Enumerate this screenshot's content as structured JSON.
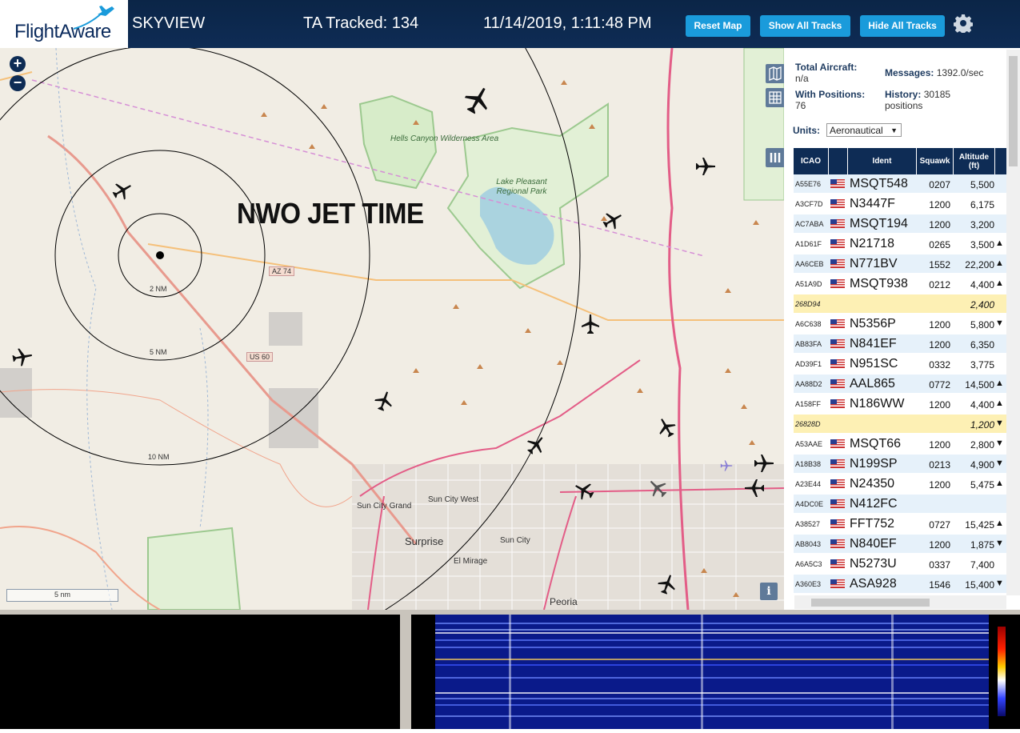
{
  "header": {
    "logo_text": "FlightAware",
    "app_name": "SKYVIEW",
    "ta_tracked": "TA Tracked: 134",
    "datetime": "11/14/2019, 1:11:48 PM",
    "buttons": {
      "reset_map": "Reset Map",
      "show_all_tracks": "Show All Tracks",
      "hide_all_tracks": "Hide All Tracks"
    }
  },
  "map": {
    "overlay_title": "NWO JET TIME",
    "range_rings": [
      "2 NM",
      "5 NM",
      "10 NM"
    ],
    "scale_label": "5 nm",
    "places": {
      "hells_canyon": "Hells Canyon Wilderness Area",
      "lake_pleasant": "Lake Pleasant Regional Park",
      "sun_city_grand": "Sun City Grand",
      "sun_city_west": "Sun City West",
      "surprise": "Surprise",
      "sun_city": "Sun City",
      "el_mirage": "El Mirage",
      "peoria": "Peoria"
    },
    "roads": {
      "az74": "AZ 74",
      "us60": "US 60"
    }
  },
  "sidebar": {
    "total_aircraft_label": "Total Aircraft:",
    "total_aircraft_value": "n/a",
    "with_positions_label": "With Positions:",
    "with_positions_value": "76",
    "messages_label": "Messages:",
    "messages_value": "1392.0/sec",
    "history_label": "History:",
    "history_value": "30185 positions",
    "units_label": "Units:",
    "units_value": "Aeronautical",
    "columns": [
      "ICAO",
      "Ident",
      "Squawk",
      "Altitude (ft)"
    ],
    "rows": [
      {
        "icao": "A55E76",
        "ident": "MSQT548",
        "squawk": "0207",
        "alt": "5,500",
        "trend": "",
        "flag": true
      },
      {
        "icao": "A3CF7D",
        "ident": "N3447F",
        "squawk": "1200",
        "alt": "6,175",
        "trend": "",
        "flag": true
      },
      {
        "icao": "AC7ABA",
        "ident": "MSQT194",
        "squawk": "1200",
        "alt": "3,200",
        "trend": "",
        "flag": true
      },
      {
        "icao": "A1D61F",
        "ident": "N21718",
        "squawk": "0265",
        "alt": "3,500",
        "trend": "▲",
        "flag": true
      },
      {
        "icao": "AA6CEB",
        "ident": "N771BV",
        "squawk": "1552",
        "alt": "22,200",
        "trend": "▲",
        "flag": true
      },
      {
        "icao": "A51A9D",
        "ident": "MSQT938",
        "squawk": "0212",
        "alt": "4,400",
        "trend": "▲",
        "flag": true
      },
      {
        "icao": "268D94",
        "ident": "",
        "squawk": "",
        "alt": "2,400",
        "trend": "",
        "flag": false
      },
      {
        "icao": "A6C638",
        "ident": "N5356P",
        "squawk": "1200",
        "alt": "5,800",
        "trend": "▼",
        "flag": true
      },
      {
        "icao": "AB83FA",
        "ident": "N841EF",
        "squawk": "1200",
        "alt": "6,350",
        "trend": "",
        "flag": true
      },
      {
        "icao": "AD39F1",
        "ident": "N951SC",
        "squawk": "0332",
        "alt": "3,775",
        "trend": "",
        "flag": true
      },
      {
        "icao": "AA88D2",
        "ident": "AAL865",
        "squawk": "0772",
        "alt": "14,500",
        "trend": "▲",
        "flag": true
      },
      {
        "icao": "A158FF",
        "ident": "N186WW",
        "squawk": "1200",
        "alt": "4,400",
        "trend": "▲",
        "flag": true
      },
      {
        "icao": "26828D",
        "ident": "",
        "squawk": "",
        "alt": "1,200",
        "trend": "▼",
        "flag": false
      },
      {
        "icao": "A53AAE",
        "ident": "MSQT66",
        "squawk": "1200",
        "alt": "2,800",
        "trend": "▼",
        "flag": true
      },
      {
        "icao": "A18B38",
        "ident": "N199SP",
        "squawk": "0213",
        "alt": "4,900",
        "trend": "▼",
        "flag": true
      },
      {
        "icao": "A23E44",
        "ident": "N24350",
        "squawk": "1200",
        "alt": "5,475",
        "trend": "▲",
        "flag": true
      },
      {
        "icao": "A4DC0E",
        "ident": "N412FC",
        "squawk": "",
        "alt": "",
        "trend": "",
        "flag": true
      },
      {
        "icao": "A38527",
        "ident": "FFT752",
        "squawk": "0727",
        "alt": "15,425",
        "trend": "▲",
        "flag": true
      },
      {
        "icao": "AB8043",
        "ident": "N840EF",
        "squawk": "1200",
        "alt": "1,875",
        "trend": "▼",
        "flag": true
      },
      {
        "icao": "A6A5C3",
        "ident": "N5273U",
        "squawk": "0337",
        "alt": "7,400",
        "trend": "",
        "flag": true
      },
      {
        "icao": "A360E3",
        "ident": "ASA928",
        "squawk": "1546",
        "alt": "15,400",
        "trend": "▼",
        "flag": true
      }
    ]
  },
  "colors": {
    "header_bg": "#0e2c55",
    "button": "#1a9bdb",
    "row_even": "#e6f1fa",
    "row_highlight": "#fdf0b4",
    "map_bg": "#f1ede4"
  }
}
